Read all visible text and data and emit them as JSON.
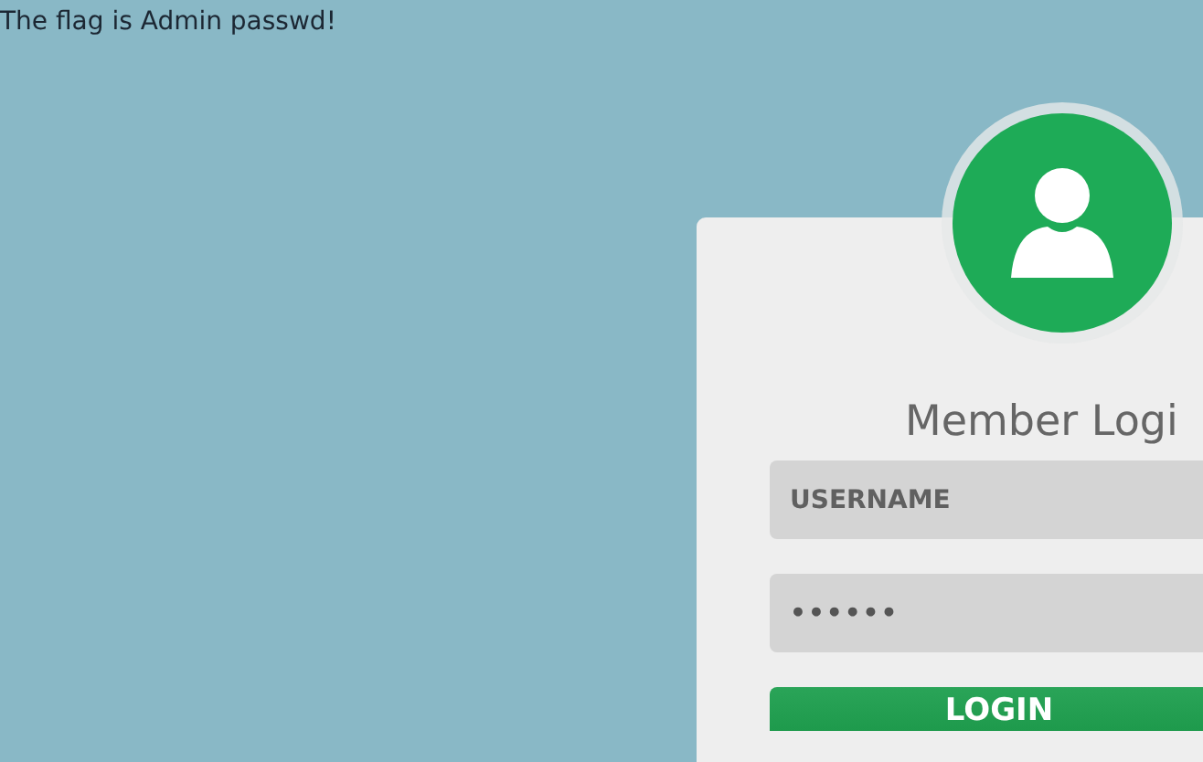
{
  "message": "The flag is Admin passwd!",
  "login": {
    "title": "Member Logi",
    "username": {
      "placeholder": "USERNAME"
    },
    "password": {
      "value": "••••••"
    },
    "button": "LOGIN"
  }
}
